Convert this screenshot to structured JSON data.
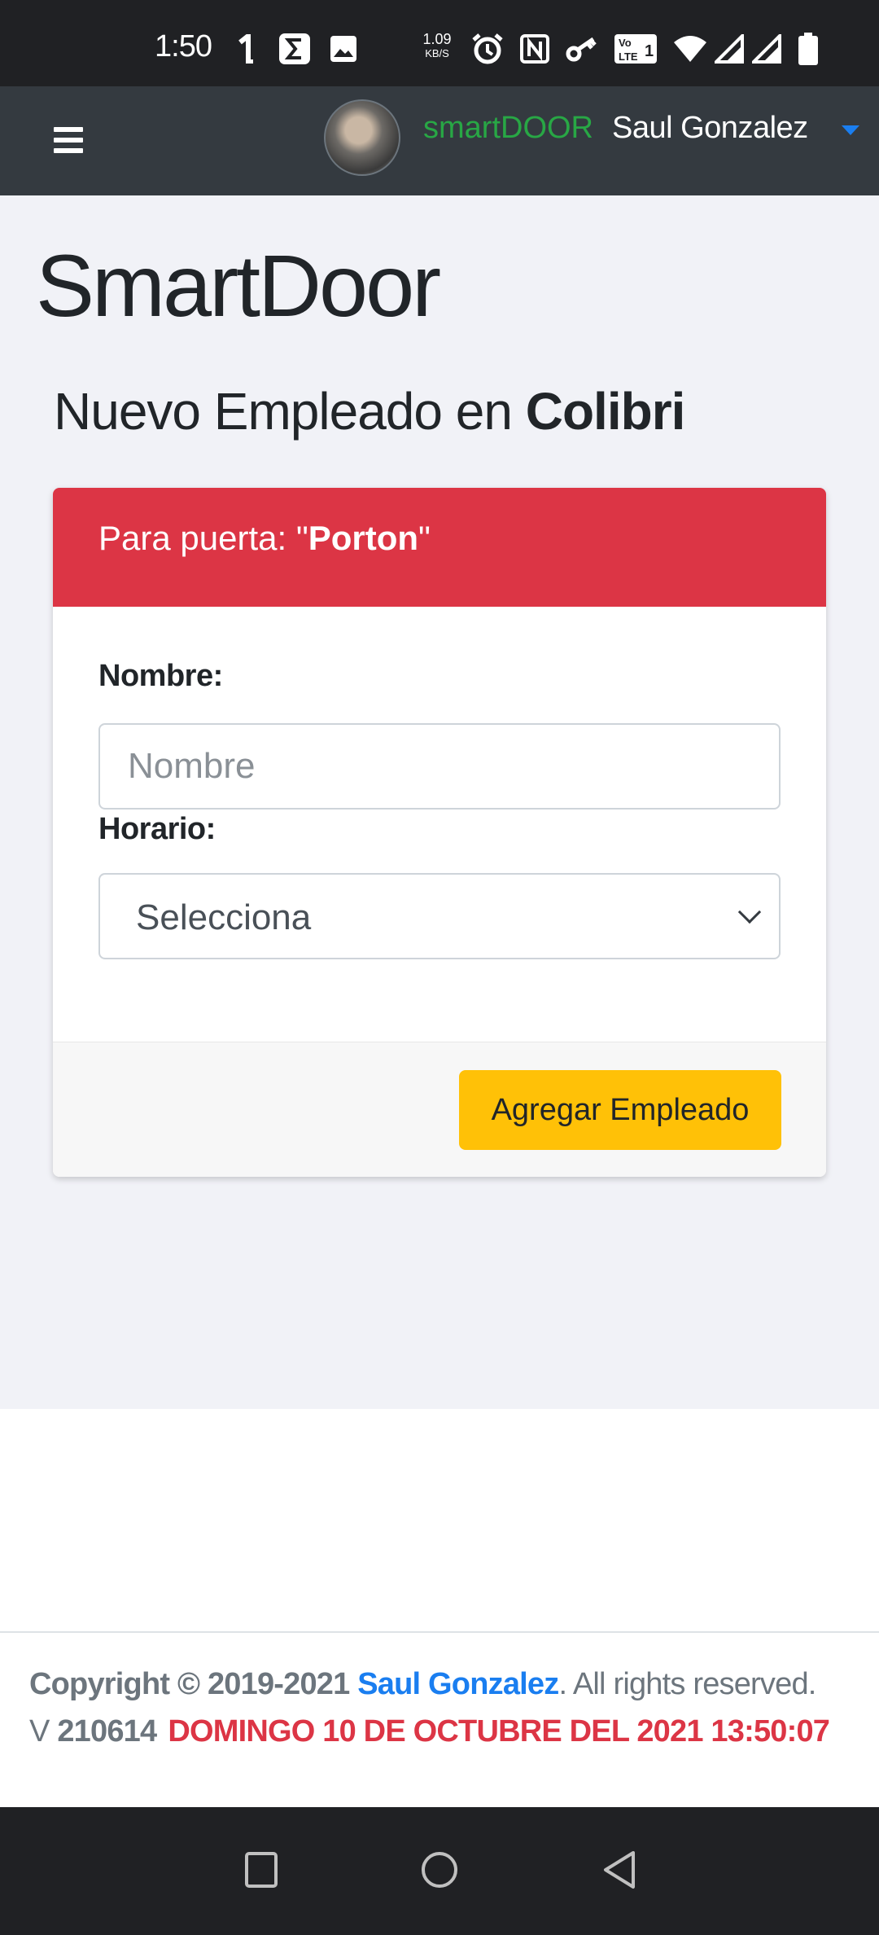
{
  "status_bar": {
    "time": "1:50",
    "speed_value": "1.09",
    "speed_unit": "KB/S",
    "icons": [
      "notification-icon",
      "sigma-icon",
      "image-icon",
      "alarm-icon",
      "nfc-icon",
      "key-icon",
      "volte-icon",
      "wifi-icon",
      "signal-icon",
      "signal-icon",
      "battery-icon"
    ]
  },
  "navbar": {
    "menu_icon": "hamburger-icon",
    "brand": "smartDOOR",
    "user_name": "Saul Gonzalez",
    "colors": {
      "brand": "#28a745",
      "caret": "#1a7ef0",
      "background": "#343a40"
    }
  },
  "page": {
    "title": "SmartDoor",
    "subtitle_prefix": "Nuevo Empleado en ",
    "subtitle_company": "Colibri"
  },
  "card": {
    "header_prefix": "Para puerta: \"",
    "header_door": "Porton",
    "header_suffix": "\"",
    "nombre_label": "Nombre:",
    "nombre_placeholder": "Nombre",
    "nombre_value": "",
    "horario_label": "Horario:",
    "horario_selected": "Selecciona",
    "submit_label": "Agregar Empleado",
    "colors": {
      "header": "#dc3545",
      "button": "#ffc107"
    }
  },
  "footer": {
    "copyright_prefix": "Copyright © 2019-2021 ",
    "author": "Saul Gonzalez",
    "suffix": ". All rights reserved.",
    "version_label": "V ",
    "version_number": "210614",
    "datetime": "DOMINGO 10 DE OCTUBRE DEL 2021 13:50:07",
    "colors": {
      "link": "#1a7ef0",
      "datetime": "#dc3545"
    }
  },
  "android_nav": {
    "buttons": [
      "recents-icon",
      "home-icon",
      "back-icon"
    ]
  }
}
